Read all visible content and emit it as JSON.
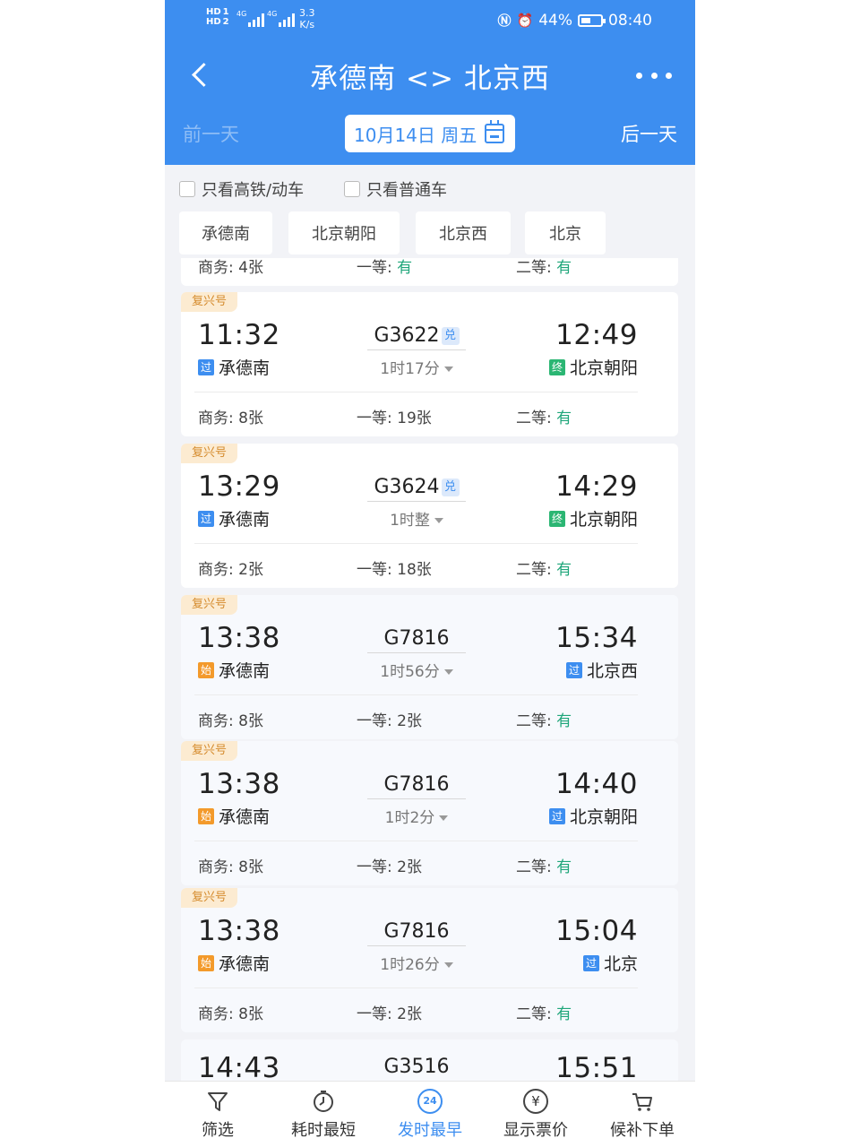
{
  "status_bar": {
    "left_labels": [
      "HD",
      "HD"
    ],
    "network": [
      "4G",
      "4G"
    ],
    "speed": "3.3",
    "speed_unit": "K/s",
    "battery": "44%",
    "time": "08:40"
  },
  "nav": {
    "title": "承德南 <> 北京西"
  },
  "date_row": {
    "prev": "前一天",
    "date": "10月14日 周五",
    "next": "后一天"
  },
  "filters": {
    "high_speed": "只看高铁/动车",
    "normal": "只看普通车"
  },
  "station_tabs": [
    "承德南",
    "北京朝阳",
    "北京西",
    "北京"
  ],
  "partial_top": {
    "business": "商务: 4张",
    "first_label": "一等: ",
    "first_value": "有",
    "second_label": "二等: ",
    "second_value": "有"
  },
  "trains": [
    {
      "badge": "复兴号",
      "dep": "11:32",
      "dep_tag": "过",
      "dep_station": "承德南",
      "train": "G3622",
      "dui": "兑",
      "duration": "1时17分",
      "arr": "12:49",
      "arr_tag": "终",
      "arr_station": "北京朝阳",
      "business": "商务: 8张",
      "first": "一等: 19张",
      "second_label": "二等: ",
      "second": "有"
    },
    {
      "badge": "复兴号",
      "dep": "13:29",
      "dep_tag": "过",
      "dep_station": "承德南",
      "train": "G3624",
      "dui": "兑",
      "duration": "1时整",
      "arr": "14:29",
      "arr_tag": "终",
      "arr_station": "北京朝阳",
      "business": "商务: 2张",
      "first": "一等: 18张",
      "second_label": "二等: ",
      "second": "有"
    },
    {
      "badge": "复兴号",
      "dep": "13:38",
      "dep_tag": "始",
      "dep_station": "承德南",
      "train": "G7816",
      "dui": "",
      "duration": "1时56分",
      "arr": "15:34",
      "arr_tag": "过",
      "arr_station": "北京西",
      "business": "商务: 8张",
      "first": "一等: 2张",
      "second_label": "二等: ",
      "second": "有"
    },
    {
      "badge": "复兴号",
      "dep": "13:38",
      "dep_tag": "始",
      "dep_station": "承德南",
      "train": "G7816",
      "dui": "",
      "duration": "1时2分",
      "arr": "14:40",
      "arr_tag": "过",
      "arr_station": "北京朝阳",
      "business": "商务: 8张",
      "first": "一等: 2张",
      "second_label": "二等: ",
      "second": "有"
    },
    {
      "badge": "复兴号",
      "dep": "13:38",
      "dep_tag": "始",
      "dep_station": "承德南",
      "train": "G7816",
      "dui": "",
      "duration": "1时26分",
      "arr": "15:04",
      "arr_tag": "过",
      "arr_station": "北京",
      "business": "商务: 8张",
      "first": "一等: 2张",
      "second_label": "二等: ",
      "second": "有"
    }
  ],
  "partial_bottom": {
    "dep": "14:43",
    "train": "G3516",
    "arr": "15:51"
  },
  "tabbar": {
    "filter": "筛选",
    "shortest": "耗时最短",
    "earliest": "发时最早",
    "earliest_icon_text": "24",
    "price": "显示票价",
    "price_icon_text": "¥",
    "waitlist": "候补下单"
  },
  "colors": {
    "primary": "#3d8ef0",
    "available": "#1fa67a",
    "badge_bg": "#fcebd1",
    "badge_text": "#d58b2d"
  }
}
